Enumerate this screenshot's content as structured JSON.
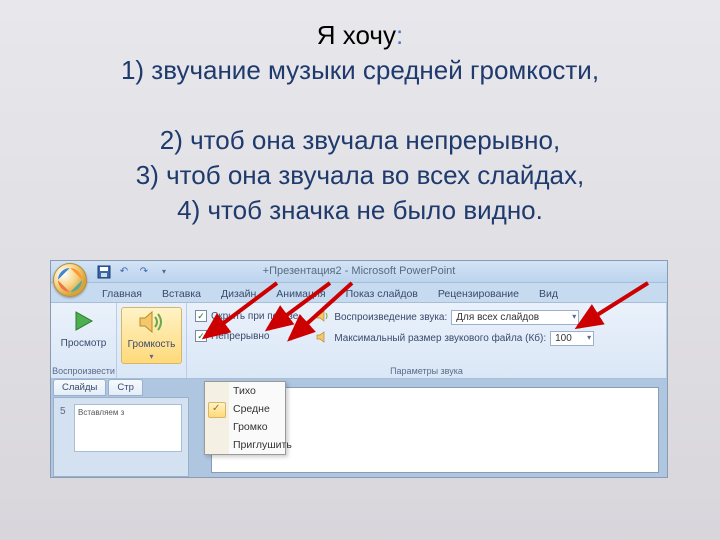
{
  "header": {
    "prefix_black": "Я хочу",
    "colon": ":",
    "line1": "1) звучание музыки средней громкости,",
    "line2": "2) чтоб она звучала непрерывно,",
    "line3": "3) чтоб она звучала во всех слайдах,",
    "line4": "4) чтоб значка не было видно."
  },
  "titlebar": {
    "title": "+Презентация2 - Microsoft PowerPoint"
  },
  "tabs": {
    "home": "Главная",
    "insert": "Вставка",
    "design": "Дизайн",
    "animation": "Анимация",
    "slideshow": "Показ слайдов",
    "review": "Рецензирование",
    "view": "Вид"
  },
  "ribbon": {
    "group_play": "Воспроизвести",
    "preview": "Просмотр",
    "volume": "Громкость",
    "hide_on_show": "Скрыть при показе",
    "continuous": "Непрерывно",
    "play_sound_label": "Воспроизведение звука:",
    "play_sound_value": "Для всех слайдов",
    "max_size_label": "Максимальный размер звукового файла (Кб):",
    "max_size_value": "100",
    "group_params": "Параметры звука"
  },
  "menu": {
    "quiet": "Тихо",
    "medium": "Средне",
    "loud": "Громко",
    "mute": "Приглушить"
  },
  "left_panel": {
    "tab_slides": "Слайды",
    "tab_outline": "Стр",
    "slide_num": "5",
    "thumb_text": "Вставляем з"
  }
}
